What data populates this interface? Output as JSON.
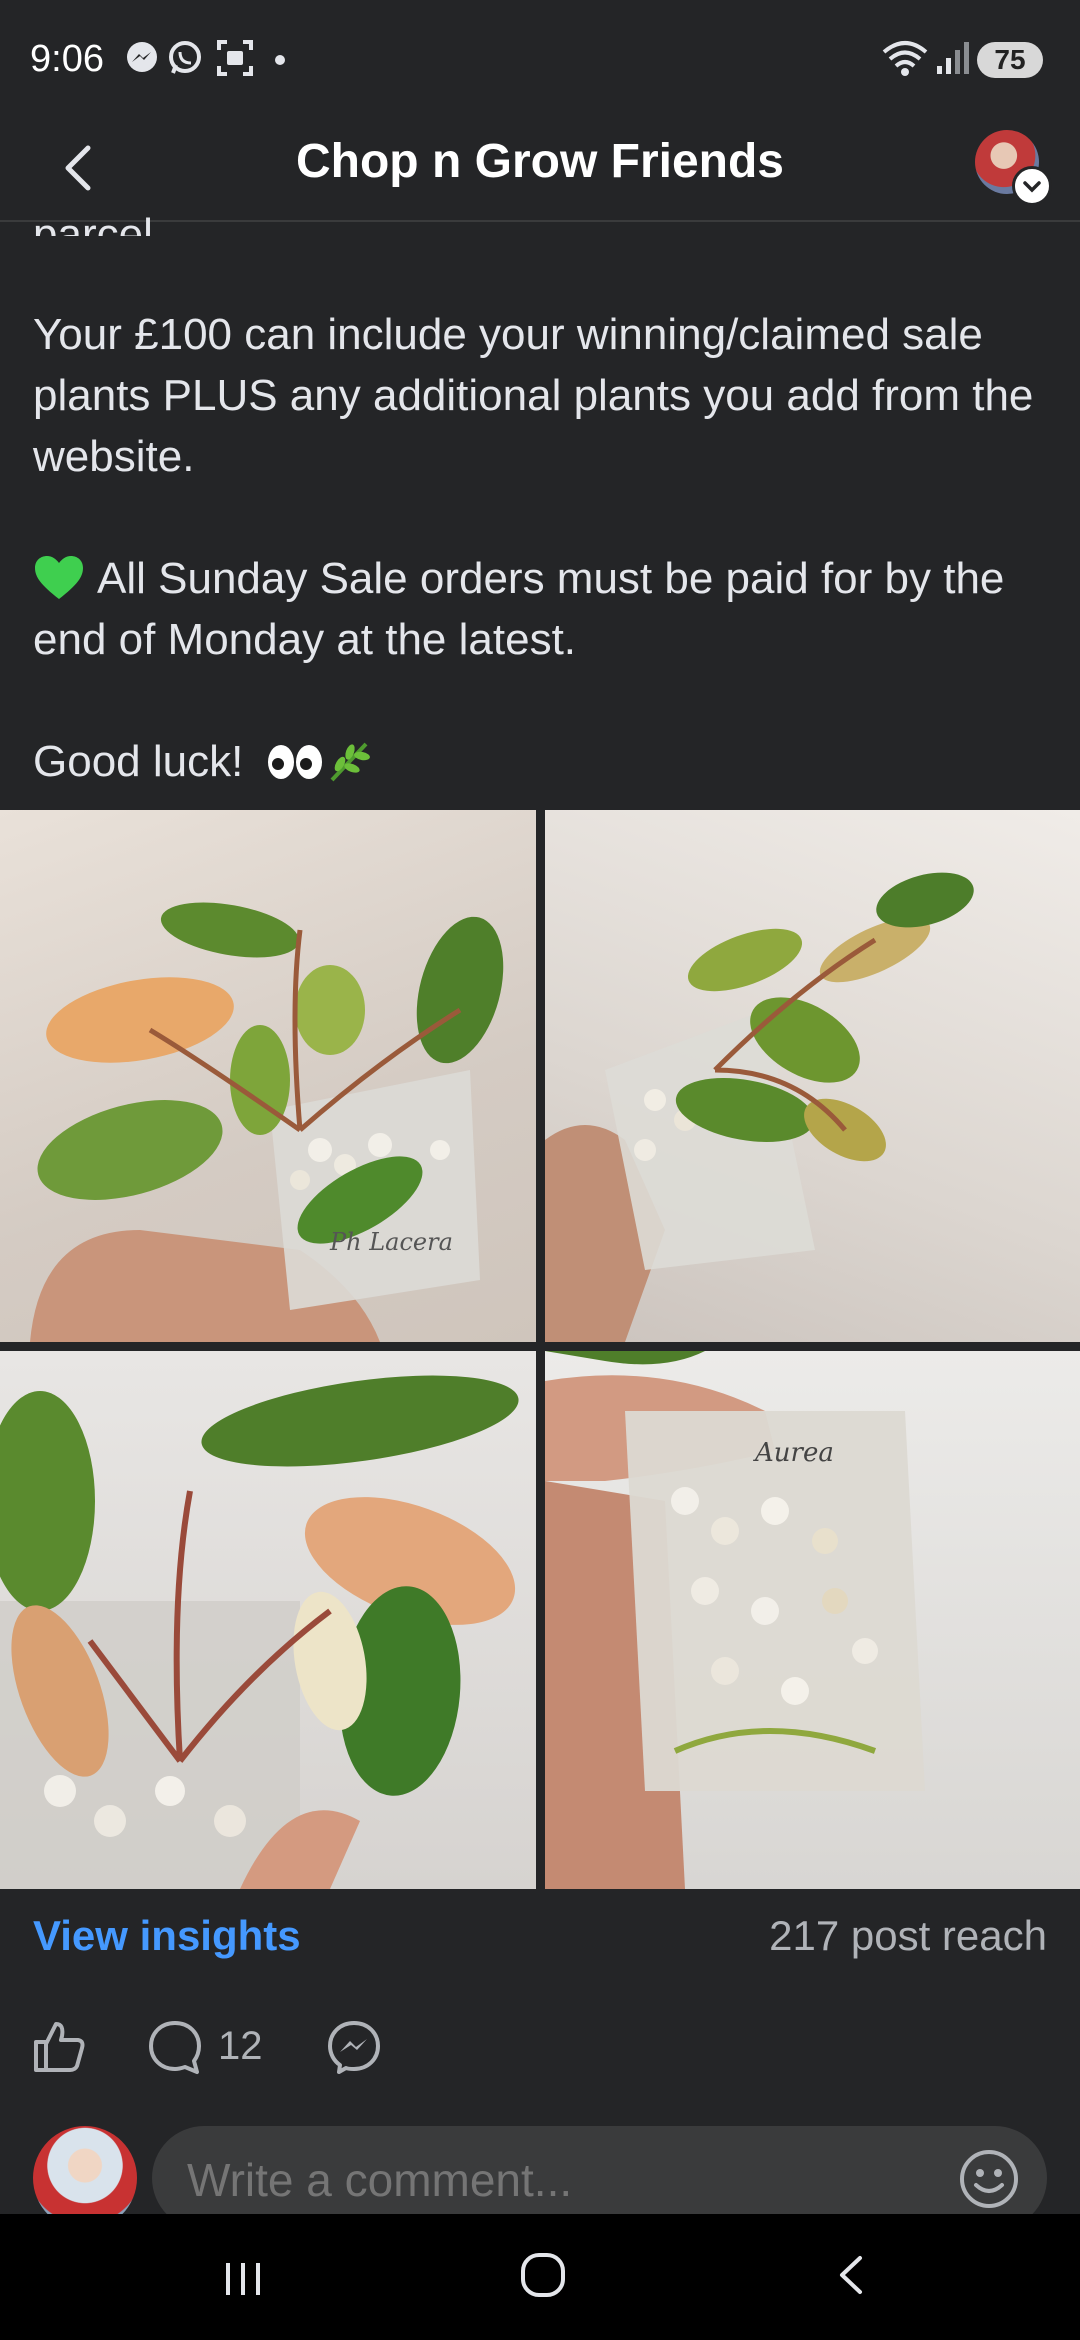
{
  "status_bar": {
    "time": "9:06",
    "battery": "75",
    "icons": [
      "messenger-icon",
      "whatsapp-icon",
      "screenshot-icon",
      "wifi-icon",
      "signal-icon"
    ]
  },
  "header": {
    "title": "Chop n Grow Friends"
  },
  "post": {
    "cut_text": "parcel.",
    "paragraphs": [
      "Your £100 can include your winning/claimed sale plants PLUS any additional plants you add from the website.",
      "All Sunday Sale orders must be paid for by the end of Monday at the latest.",
      "Good luck!"
    ],
    "emoji": [
      "green-heart",
      "eyes",
      "herb"
    ]
  },
  "photos": {
    "count": 4,
    "handwriting": [
      "Ph Lacera Aurea",
      "Aurea"
    ]
  },
  "stats": {
    "insights_label": "View insights",
    "reach_label": "217 post reach"
  },
  "actions": {
    "comment_count": "12"
  },
  "comment_box": {
    "placeholder": "Write a comment..."
  },
  "colors": {
    "background": "#242527",
    "accent": "#4599ff",
    "secondary_text": "#b0b3b8"
  }
}
